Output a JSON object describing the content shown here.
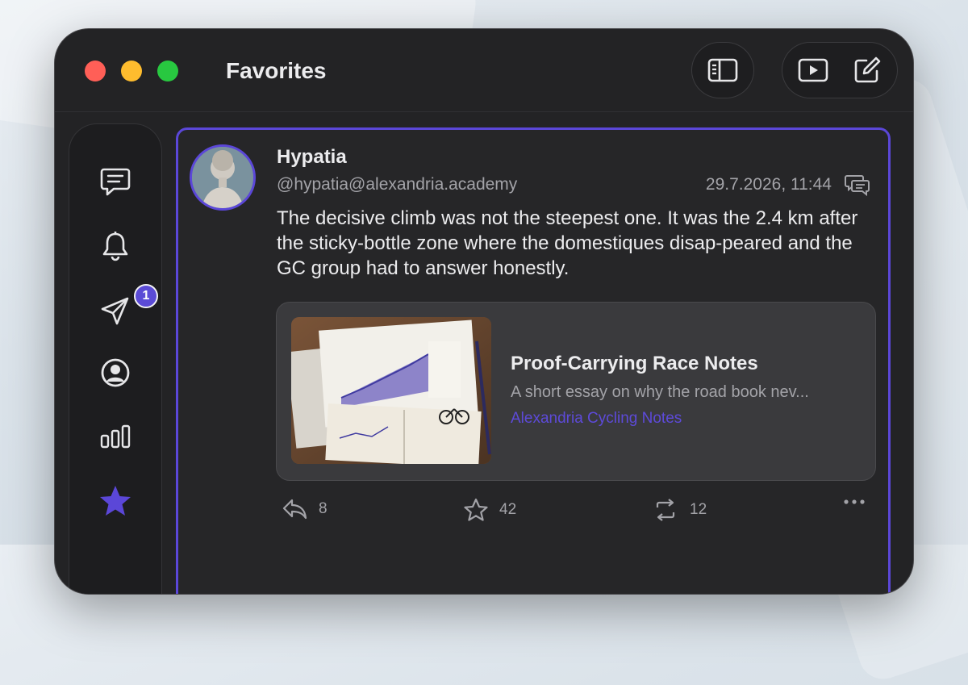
{
  "window": {
    "title": "Favorites"
  },
  "toolbar": {
    "sidebar_toggle_icon": "sidebar-icon",
    "play_icon": "play-icon",
    "compose_icon": "compose-icon"
  },
  "sidebar": {
    "items": [
      {
        "name": "timeline",
        "icon": "chat-bubble-icon"
      },
      {
        "name": "notifications",
        "icon": "bell-icon"
      },
      {
        "name": "messages",
        "icon": "paper-plane-icon",
        "badge": "1"
      },
      {
        "name": "profile",
        "icon": "person-circle-icon"
      },
      {
        "name": "lists",
        "icon": "bars-icon"
      },
      {
        "name": "favorites",
        "icon": "star-icon",
        "active": true
      }
    ]
  },
  "post": {
    "author": "Hypatia",
    "handle": "@hypatia@alexandria.academy",
    "timestamp": "29.7.2026, 11:44",
    "text": "The decisive climb was not the steepest one. It was the 2.4 km after the sticky-bottle zone where the domestiques disap-peared and the GC group had to answer honestly.",
    "link_card": {
      "title": "Proof-Carrying Race Notes",
      "description": "A short essay on why the road book nev...",
      "source": "Alexandria Cycling Notes"
    },
    "actions": {
      "replies": "8",
      "favorites": "42",
      "boosts": "12"
    }
  },
  "colors": {
    "accent": "#5b47d8",
    "window_bg": "#232325",
    "text_primary": "#ececee",
    "text_secondary": "#a3a3a8"
  }
}
